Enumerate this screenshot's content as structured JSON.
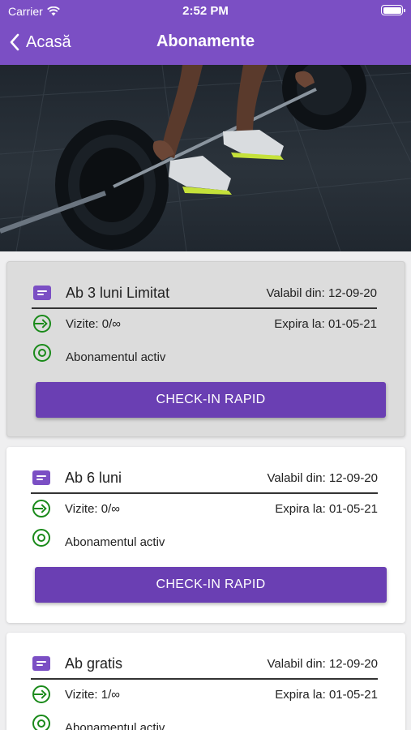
{
  "status_bar": {
    "carrier": "Carrier",
    "time": "2:52 PM"
  },
  "nav": {
    "back_label": "Acasă",
    "title": "Abonamente"
  },
  "colors": {
    "accent": "#7b4fc4",
    "button": "#6a3fb3",
    "active_green": "#1a8a1a"
  },
  "subscriptions": [
    {
      "name": "Ab 3 luni Limitat",
      "valid_from": "Valabil din: 12-09-20",
      "visits": "Vizite: 0/∞",
      "expires": "Expira la: 01-05-21",
      "status": "Abonamentul activ",
      "checkin_label": "CHECK-IN RAPID"
    },
    {
      "name": "Ab 6 luni",
      "valid_from": "Valabil din: 12-09-20",
      "visits": "Vizite: 0/∞",
      "expires": "Expira la: 01-05-21",
      "status": "Abonamentul activ",
      "checkin_label": "CHECK-IN RAPID"
    },
    {
      "name": "Ab gratis",
      "valid_from": "Valabil din: 12-09-20",
      "visits": "Vizite: 1/∞",
      "expires": "Expira la: 01-05-21",
      "status": "Abonamentul activ"
    }
  ]
}
